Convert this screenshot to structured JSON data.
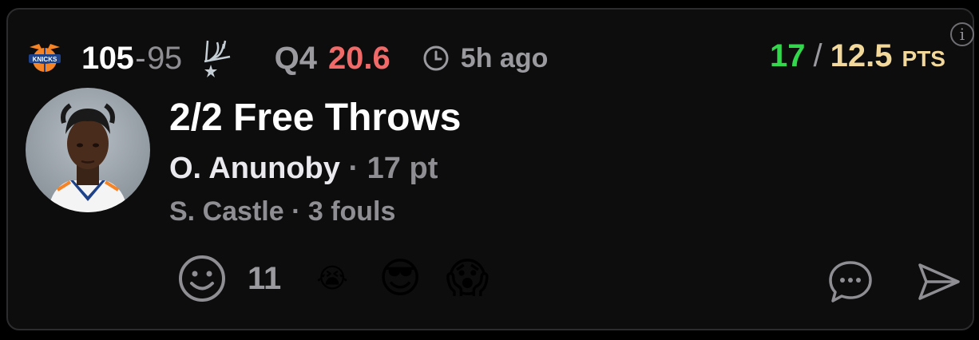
{
  "game": {
    "home_score": "105",
    "score_sep": "-",
    "away_score": "95",
    "quarter": "Q4",
    "clock": "20.6",
    "time_ago": "5h ago",
    "home_team_icon": "knicks-logo-icon",
    "away_team_icon": "spurs-logo-icon"
  },
  "stat_line": {
    "actual": "17",
    "separator": "/",
    "line": "12.5",
    "unit": "PTS"
  },
  "play": {
    "title": "2/2 Free Throws",
    "player_name": "O. Anunoby",
    "player_detail": " · 17 pt",
    "secondary": "S. Castle · 3 fouls"
  },
  "reactions": {
    "count": "11",
    "emojis": [
      "😭",
      "😎",
      "😱"
    ]
  },
  "colors": {
    "clock": "#f06a6a",
    "actual": "#32d74b",
    "line": "#f2d89b"
  },
  "info": "i"
}
